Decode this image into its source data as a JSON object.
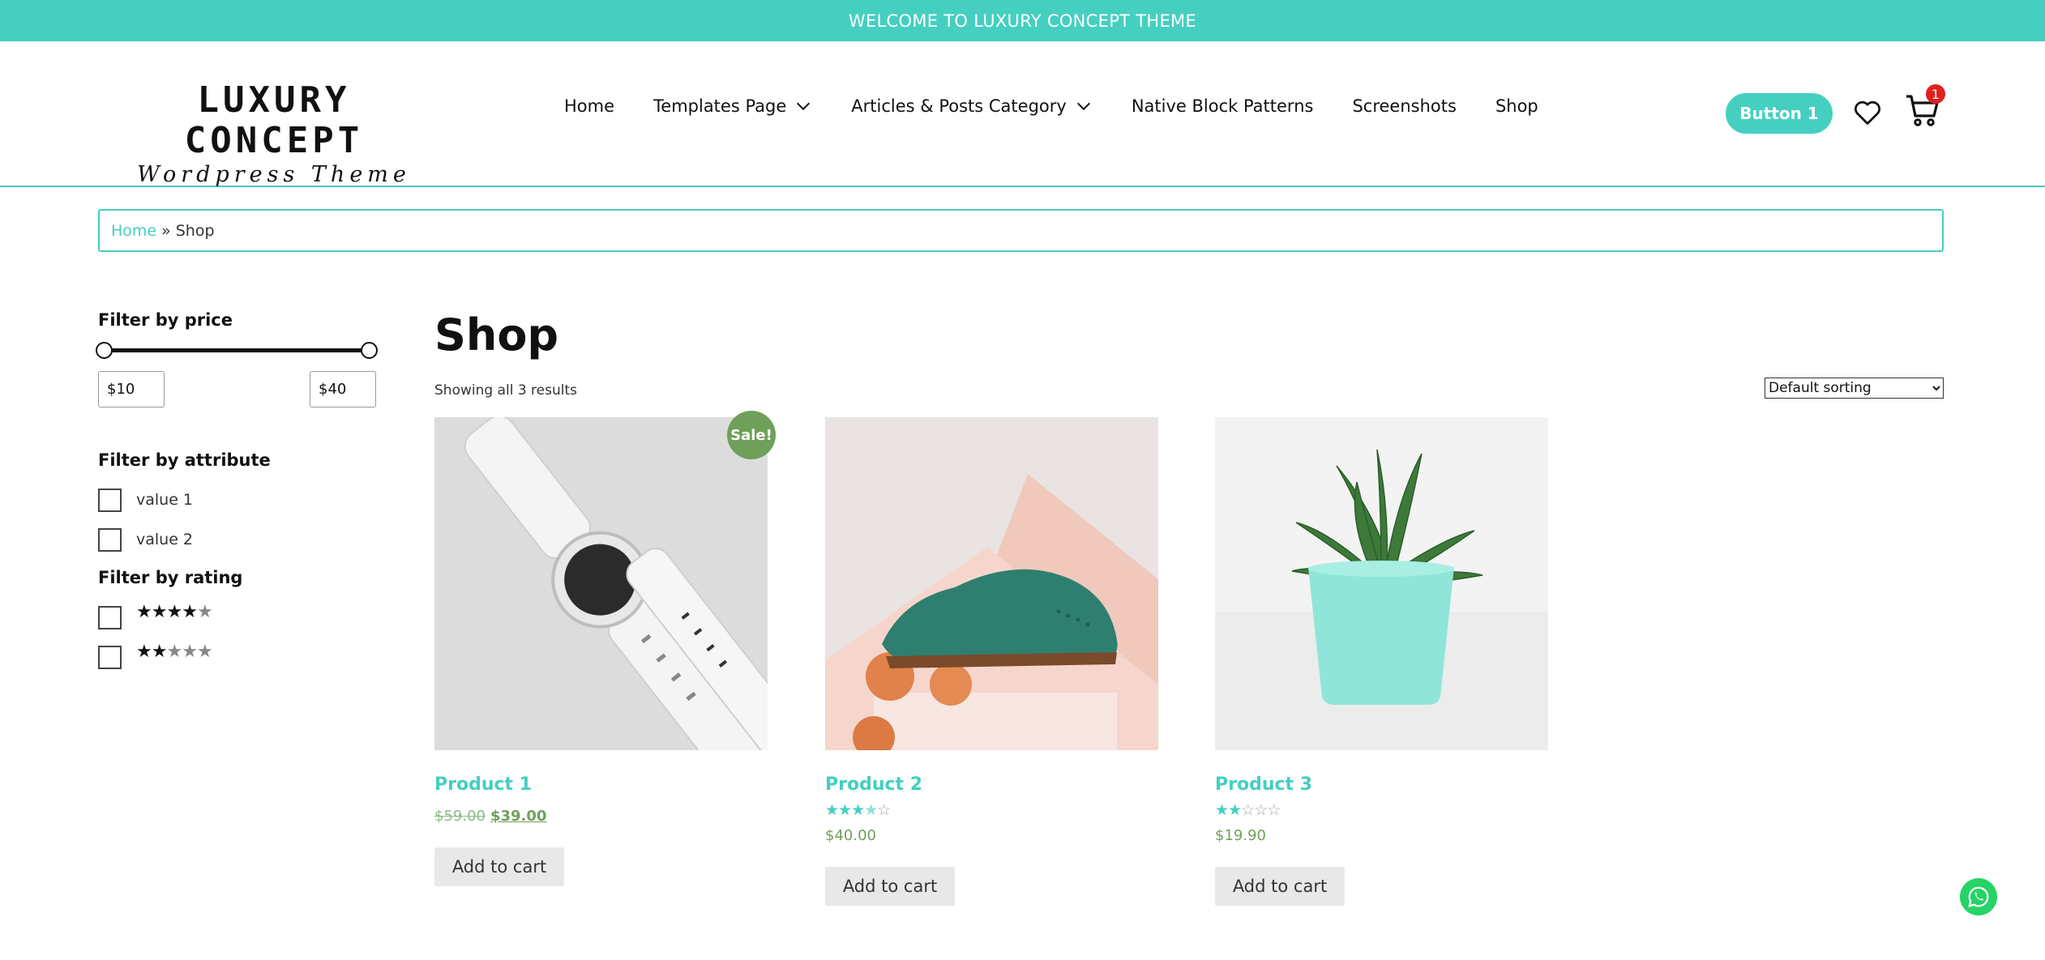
{
  "topbar": {
    "text": "WELCOME TO LUXURY CONCEPT THEME"
  },
  "logo": {
    "title": "LUXURY CONCEPT",
    "subtitle": "Wordpress Theme"
  },
  "nav": {
    "items": [
      {
        "label": "Home"
      },
      {
        "label": "Templates Page"
      },
      {
        "label": "Articles & Posts Category"
      },
      {
        "label": "Native Block Patterns"
      },
      {
        "label": "Screenshots"
      },
      {
        "label": "Shop"
      }
    ]
  },
  "header": {
    "button_label": "Button 1",
    "cart_count": "1"
  },
  "breadcrumb": {
    "home": "Home",
    "separator": "»",
    "current": "Shop"
  },
  "sidebar": {
    "price_heading": "Filter by price",
    "price_min": "$10",
    "price_max": "$40",
    "attribute_heading": "Filter by attribute",
    "attributes": [
      "value 1",
      "value 2"
    ],
    "rating_heading": "Filter by rating",
    "ratings": [
      4,
      2
    ]
  },
  "shop": {
    "title": "Shop",
    "showing": "Showing all 3 results",
    "sort_selected": "Default sorting"
  },
  "products": [
    {
      "name": "Product 1",
      "old_price": "$59.00",
      "price": "$39.00",
      "sale_label": "Sale!",
      "rating": 0,
      "button": "Add to cart"
    },
    {
      "name": "Product 2",
      "price": "$40.00",
      "rating": 3.5,
      "button": "Add to cart"
    },
    {
      "name": "Product 3",
      "price": "$19.90",
      "rating": 2,
      "button": "Add to cart"
    }
  ],
  "colors": {
    "accent": "#45cfc1",
    "sale": "#6fa05a",
    "badge": "#e0201f",
    "whatsapp": "#25d366"
  },
  "icons": [
    "chevron-down-icon",
    "heart-icon",
    "cart-icon",
    "star-icon",
    "whatsapp-icon"
  ]
}
